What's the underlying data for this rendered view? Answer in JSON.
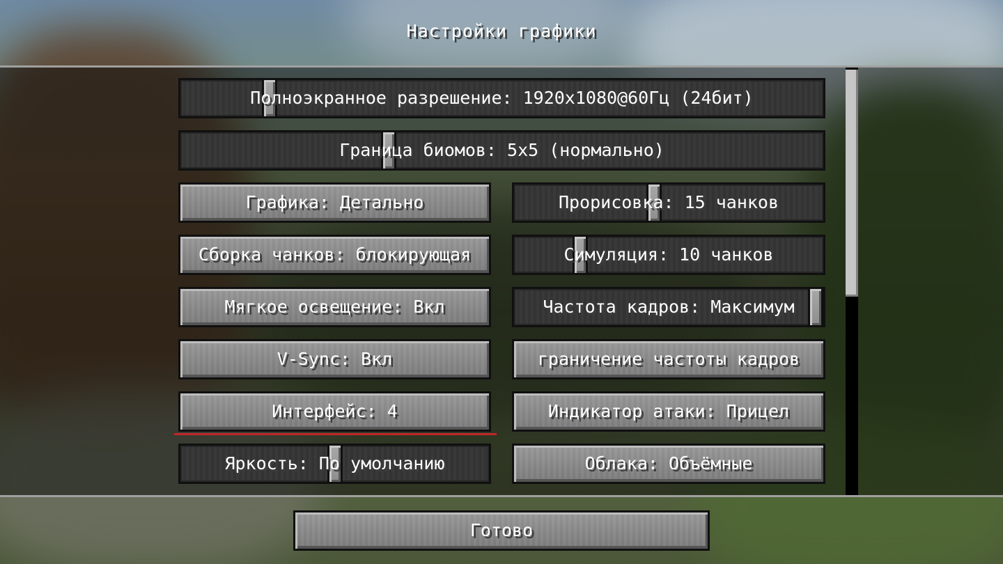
{
  "screen": {
    "title": "Настройки графики"
  },
  "options": {
    "fullscreen_resolution": {
      "label": "Полноэкранное разрешение: 1920x1080@60Гц (24бит)",
      "slider_value": 0.13
    },
    "biome_blend": {
      "label": "Граница биомов: 5x5 (нормально)",
      "slider_value": 0.32
    },
    "graphics": {
      "label": "Графика: Детально"
    },
    "render_distance": {
      "label": "Прорисовка: 15 чанков",
      "slider_value": 0.45
    },
    "chunk_builder": {
      "label": "Сборка чанков: блокирующая"
    },
    "simulation_distance": {
      "label": "Симуляция: 10 чанков",
      "slider_value": 0.2
    },
    "smooth_lighting": {
      "label": "Мягкое освещение: Вкл"
    },
    "max_framerate": {
      "label": "Частота кадров: Максимум",
      "slider_value": 1.0
    },
    "vsync": {
      "label": "V-Sync: Вкл"
    },
    "framerate_limit": {
      "label": "граничение частоты кадров"
    },
    "gui_scale": {
      "label": "Интерфейс: 4"
    },
    "attack_indicator": {
      "label": "Индикатор атаки: Прицел"
    },
    "brightness": {
      "label": "Яркость: По умолчанию",
      "slider_value": 0.5
    },
    "clouds": {
      "label": "Облака: Объёмные"
    }
  },
  "footer": {
    "done_label": "Готово"
  },
  "colors": {
    "highlight_underline": "#c0262a"
  }
}
